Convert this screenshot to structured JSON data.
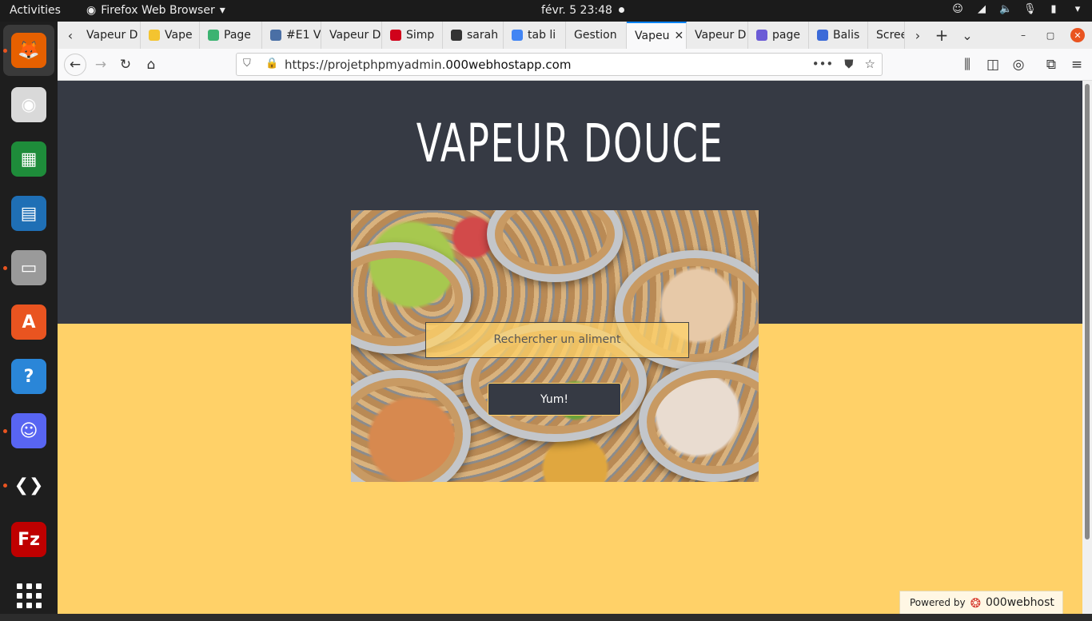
{
  "topbar": {
    "activities": "Activities",
    "app_name": "Firefox Web Browser",
    "clock": "févr. 5  23:48"
  },
  "dock": {
    "items": [
      {
        "name": "firefox-icon",
        "glyph": "🦊",
        "color": "#e66000"
      },
      {
        "name": "rhythmbox-icon",
        "glyph": "◉",
        "color": "#d9d9d9"
      },
      {
        "name": "calc-icon",
        "glyph": "▦",
        "color": "#1e8c3a"
      },
      {
        "name": "writer-icon",
        "glyph": "▤",
        "color": "#1f6fb5"
      },
      {
        "name": "files-icon",
        "glyph": "▭",
        "color": "#9a9a9a"
      },
      {
        "name": "software-icon",
        "glyph": "A",
        "color": "#e95420"
      },
      {
        "name": "help-icon",
        "glyph": "?",
        "color": "#2a86d8"
      },
      {
        "name": "discord-icon",
        "glyph": "☺",
        "color": "#5865f2"
      },
      {
        "name": "vscode-icon",
        "glyph": "❮❯",
        "color": "#1e1e1e"
      },
      {
        "name": "filezilla-icon",
        "glyph": "Fz",
        "color": "#bf0000"
      }
    ],
    "apps_grid": "show-applications"
  },
  "tabs": [
    {
      "label": "Vapeur D",
      "favicon": "#888888"
    },
    {
      "label": "Vape",
      "favicon": "#f4c430"
    },
    {
      "label": "Page",
      "favicon": "#3cb371"
    },
    {
      "label": "#E1 V",
      "favicon": "#4a6fa5"
    },
    {
      "label": "Vapeur D",
      "favicon": "#888888"
    },
    {
      "label": "Simp",
      "favicon": "#d0021b"
    },
    {
      "label": "sarah",
      "favicon": "#333333"
    },
    {
      "label": "tab li",
      "favicon": "#4285f4"
    },
    {
      "label": "Gestion",
      "favicon": "#cccccc"
    },
    {
      "label": "Vapeu",
      "favicon": "#cccccc"
    },
    {
      "label": "Vapeur D",
      "favicon": "#888888"
    },
    {
      "label": "page",
      "favicon": "#6b5bd6"
    },
    {
      "label": "Balis",
      "favicon": "#3b6ad8"
    },
    {
      "label": "Scree",
      "favicon": "#888888"
    }
  ],
  "selected_tab_index": 9,
  "navbar": {
    "url_prefix": "https://projetphpmyadmin.",
    "url_host": "000webhostapp.com"
  },
  "page": {
    "title": "VAPEUR DOUCE",
    "search_placeholder": "Rechercher un aliment",
    "submit_label": "Yum!",
    "powered_by": "Powered by",
    "powered_brand": "000webhost"
  },
  "colors": {
    "header_bg": "#363a44",
    "page_bg": "#ffd168",
    "accent_tab": "#0a84ff"
  }
}
